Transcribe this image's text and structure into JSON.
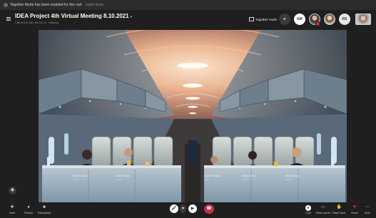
{
  "notification": {
    "text": "Together Mode has been enabled for this call.",
    "link": "Learn more"
  },
  "meeting": {
    "title": "IDEA Project 4th Virtual Meeting 8.10.2021",
    "subtitle": "Call in the call | 46:01 | 8 · Helping"
  },
  "header": {
    "together_mode_label": "Together mode",
    "participant_initials": [
      "EM",
      "RS"
    ]
  },
  "participants": [
    {
      "name": "Dimitri Ivanov",
      "role": "Guest"
    },
    {
      "name": "Marco Rossi",
      "role": "Guest"
    },
    {
      "name": "Ahmet Yilmaz",
      "role": "Guest"
    },
    {
      "name": "Elena Marin",
      "role": "Guest"
    },
    {
      "name": "Hanna Berg",
      "role": "Guest"
    }
  ],
  "bottom_left": [
    {
      "label": "Invite",
      "icon": "person-add-icon"
    },
    {
      "label": "Record",
      "icon": "record-icon"
    },
    {
      "label": "Participants",
      "icon": "people-icon"
    }
  ],
  "bottom_right": [
    {
      "label": "Chat",
      "icon": "chat-icon"
    },
    {
      "label": "Share screen",
      "icon": "share-icon"
    },
    {
      "label": "Raise hand",
      "icon": "hand-icon"
    },
    {
      "label": "React",
      "icon": "heart-icon"
    },
    {
      "label": "More",
      "icon": "more-icon"
    }
  ],
  "colors": {
    "end_call": "#c4314b",
    "accent": "#8b8cc7",
    "background": "#201f1f"
  }
}
